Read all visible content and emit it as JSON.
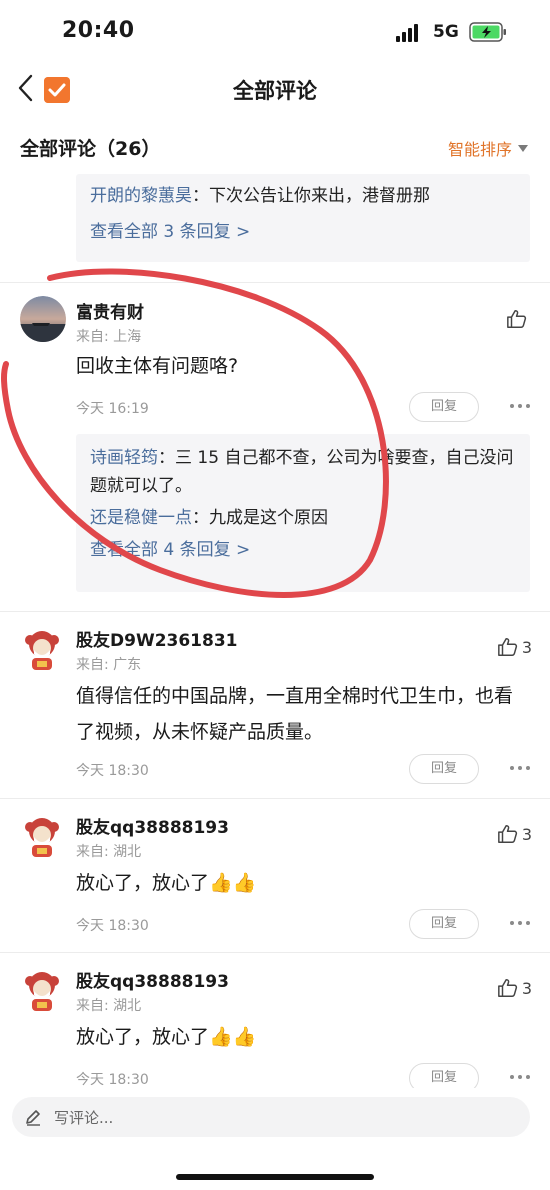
{
  "status_bar": {
    "time": "20:40",
    "network": "5G"
  },
  "nav": {
    "title": "全部评论"
  },
  "header": {
    "count_label": "全部评论（26）",
    "sort_label": "智能排序"
  },
  "top_partial": {
    "reply_user": "开朗的黎蕙昊",
    "reply_sep": "：",
    "reply_text": "下次公告让你来出，港督册那",
    "view_all": "查看全部 3 条回复 >"
  },
  "comments": [
    {
      "username": "富贵有财",
      "location": "来自: 上海",
      "content": "回收主体有问题咯?",
      "time": "今天 16:19",
      "reply_label": "回复",
      "like_count": "",
      "replies": [
        {
          "user": "诗画轻筠",
          "sep": "：",
          "text": "三 15 自己都不查，公司为啥要查，自己没问题就可以了。"
        },
        {
          "user": "还是稳健一点",
          "sep": "：",
          "text": "九成是这个原因"
        }
      ],
      "view_all": "查看全部 4 条回复 >"
    },
    {
      "username": "股友D9W2361831",
      "location": "来自: 广东",
      "content": "值得信任的中国品牌，一直用全棉时代卫生巾，也看了视频，从未怀疑产品质量。",
      "time": "今天 18:30",
      "reply_label": "回复",
      "like_count": "3"
    },
    {
      "username": "股友qq38888193",
      "location": "来自: 湖北",
      "content": "放心了，放心了👍👍",
      "time": "今天 18:30",
      "reply_label": "回复",
      "like_count": "3"
    },
    {
      "username": "股友qq38888193",
      "location": "来自: 湖北",
      "content": "放心了，放心了👍👍",
      "time": "今天 18:30",
      "reply_label": "回复",
      "like_count": "3"
    }
  ],
  "input": {
    "placeholder": "写评论..."
  },
  "colors": {
    "accent": "#e0742a",
    "link": "#4a6d9c",
    "annotation": "#e0474b"
  }
}
